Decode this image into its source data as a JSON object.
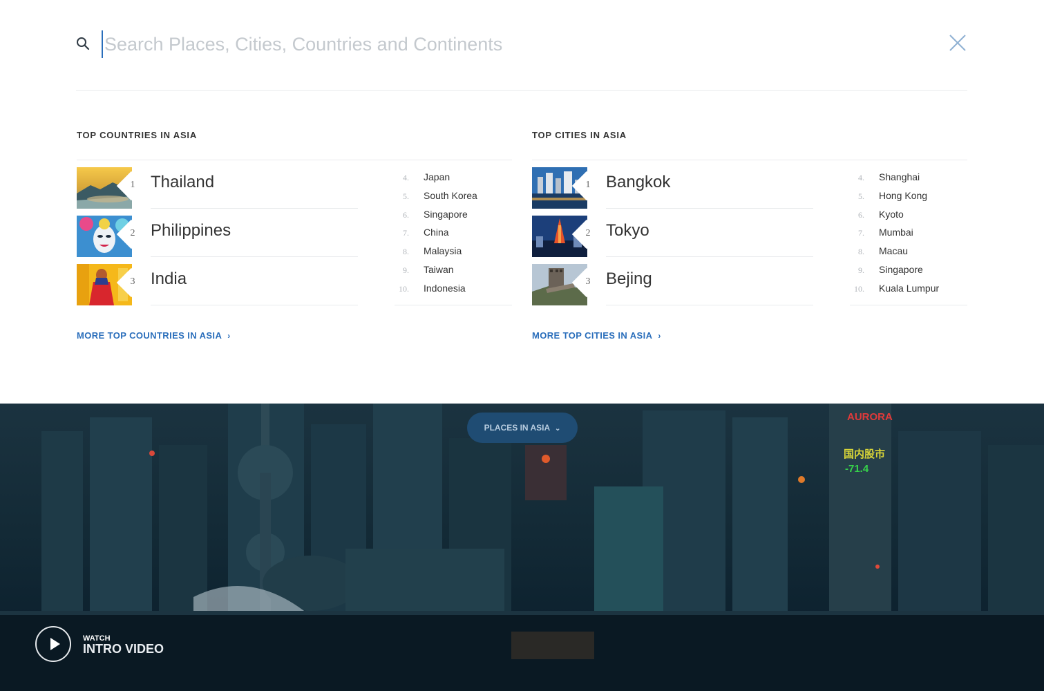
{
  "search": {
    "placeholder": "Search Places, Cities, Countries and Continents"
  },
  "countries": {
    "heading": "TOP COUNTRIES IN ASIA",
    "top": [
      {
        "rank": "1",
        "name": "Thailand"
      },
      {
        "rank": "2",
        "name": "Philippines"
      },
      {
        "rank": "3",
        "name": "India"
      }
    ],
    "rest": [
      {
        "rank": "4.",
        "name": "Japan"
      },
      {
        "rank": "5.",
        "name": "South Korea"
      },
      {
        "rank": "6.",
        "name": "Singapore"
      },
      {
        "rank": "7.",
        "name": "China"
      },
      {
        "rank": "8.",
        "name": "Malaysia"
      },
      {
        "rank": "9.",
        "name": "Taiwan"
      },
      {
        "rank": "10.",
        "name": "Indonesia"
      }
    ],
    "more_link": "MORE TOP COUNTRIES IN ASIA"
  },
  "cities": {
    "heading": "TOP CITIES IN ASIA",
    "top": [
      {
        "rank": "1",
        "name": "Bangkok"
      },
      {
        "rank": "2",
        "name": "Tokyo"
      },
      {
        "rank": "3",
        "name": "Bejing"
      }
    ],
    "rest": [
      {
        "rank": "4.",
        "name": "Shanghai"
      },
      {
        "rank": "5.",
        "name": "Hong Kong"
      },
      {
        "rank": "6.",
        "name": "Kyoto"
      },
      {
        "rank": "7.",
        "name": "Mumbai"
      },
      {
        "rank": "8.",
        "name": "Macau"
      },
      {
        "rank": "9.",
        "name": "Singapore"
      },
      {
        "rank": "10.",
        "name": "Kuala Lumpur"
      }
    ],
    "more_link": "MORE TOP CITIES IN ASIA"
  },
  "hero": {
    "places_pill": "PLACES IN ASIA",
    "watch_label": "WATCH",
    "intro_label": "INTRO VIDEO",
    "sign_1": "AURORA",
    "sign_2": "国内股市",
    "sign_3": "-71.4"
  },
  "colors": {
    "accent": "#2a6ebb",
    "pill": "#1f4c73",
    "text": "#333333"
  }
}
